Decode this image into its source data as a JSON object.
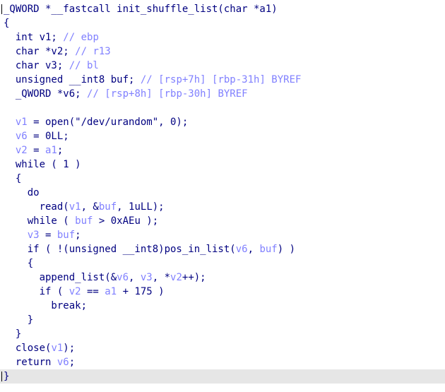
{
  "editor": {
    "lines": [
      [
        "_QWORD *__fastcall init_shuffle_list(char *a1)"
      ],
      [
        "{"
      ],
      [
        "  int v1; ",
        "// ebp"
      ],
      [
        "  char *v2; ",
        "// r13"
      ],
      [
        "  char v3; ",
        "// bl"
      ],
      [
        "  unsigned __int8 buf; ",
        "// [rsp+7h] [rbp-31h] BYREF"
      ],
      [
        "  _QWORD *v6; ",
        "// [rsp+8h] [rbp-30h] BYREF"
      ],
      [
        ""
      ],
      [
        "  ",
        "v1",
        " = open(\"/dev/urandom\", 0);"
      ],
      [
        "  ",
        "v6",
        " = 0LL;"
      ],
      [
        "  ",
        "v2",
        " = ",
        "a1",
        ";"
      ],
      [
        "  while ( 1 )"
      ],
      [
        "  {"
      ],
      [
        "    do"
      ],
      [
        "      read(",
        "v1",
        ", &",
        "buf",
        ", 1uLL);"
      ],
      [
        "    while ( ",
        "buf",
        " > 0xAEu );"
      ],
      [
        "    ",
        "v3",
        " = ",
        "buf",
        ";"
      ],
      [
        "    if ( !(unsigned __int8)pos_in_list(",
        "v6",
        ", ",
        "buf",
        ") )"
      ],
      [
        "    {"
      ],
      [
        "      append_list(&",
        "v6",
        ", ",
        "v3",
        ", *",
        "v2",
        "++);"
      ],
      [
        "      if ( ",
        "v2",
        " == ",
        "a1",
        " + 175 )"
      ],
      [
        "        break;"
      ],
      [
        "    }"
      ],
      [
        "  }"
      ],
      [
        "  close(",
        "v1",
        ");"
      ],
      [
        "  return ",
        "v6",
        ";"
      ],
      [
        "}"
      ]
    ],
    "kinds": [
      [
        "plain"
      ],
      [
        "brace"
      ],
      [
        "plain",
        "cmt"
      ],
      [
        "plain",
        "cmt"
      ],
      [
        "plain",
        "cmt"
      ],
      [
        "plain",
        "cmt"
      ],
      [
        "plain",
        "cmt"
      ],
      [
        "plain"
      ],
      [
        "plain",
        "var",
        "plain"
      ],
      [
        "plain",
        "var",
        "plain"
      ],
      [
        "plain",
        "var",
        "plain",
        "var",
        "plain"
      ],
      [
        "plain"
      ],
      [
        "plain"
      ],
      [
        "plain"
      ],
      [
        "plain",
        "var",
        "plain",
        "var",
        "plain"
      ],
      [
        "plain",
        "var",
        "plain"
      ],
      [
        "plain",
        "var",
        "plain",
        "var",
        "plain"
      ],
      [
        "plain",
        "var",
        "plain",
        "var",
        "plain"
      ],
      [
        "plain"
      ],
      [
        "plain",
        "var",
        "plain",
        "var",
        "plain",
        "var",
        "plain"
      ],
      [
        "plain",
        "var",
        "plain",
        "var",
        "plain"
      ],
      [
        "plain"
      ],
      [
        "plain"
      ],
      [
        "plain"
      ],
      [
        "plain",
        "var",
        "plain"
      ],
      [
        "plain",
        "var",
        "plain"
      ],
      [
        "brace"
      ]
    ],
    "current_line_index": 26
  }
}
